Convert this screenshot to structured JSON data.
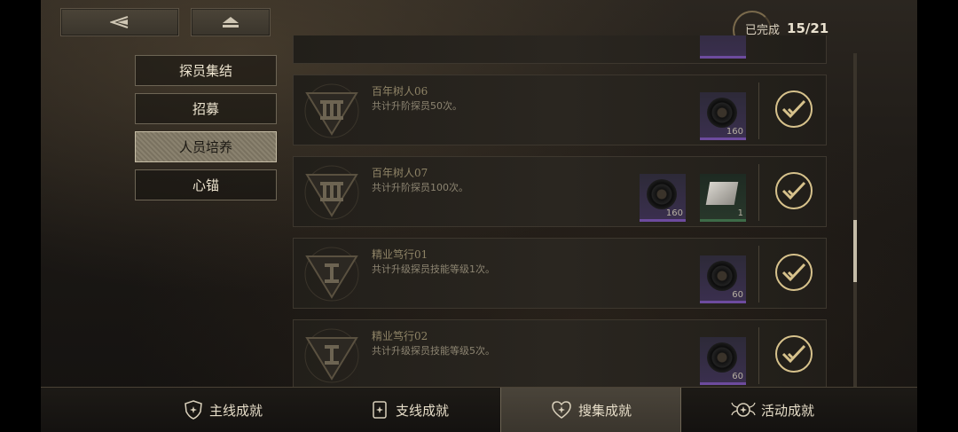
{
  "header": {
    "back_icon": "back-arrow-icon",
    "home_icon": "home-icon",
    "progress_label": "已完成",
    "progress_count": "15/21"
  },
  "sidebar": {
    "items": [
      {
        "label": "探员集结",
        "active": false
      },
      {
        "label": "招募",
        "active": false
      },
      {
        "label": "人员培养",
        "active": true
      },
      {
        "label": "心锚",
        "active": false
      }
    ]
  },
  "achievements": [
    {
      "title": "百年树人06",
      "desc": "共计升阶探员50次。",
      "emblem": "rank-III-emblem",
      "rewards": [
        {
          "icon": "record-disc",
          "qty": "160"
        }
      ],
      "completed": true
    },
    {
      "title": "百年树人07",
      "desc": "共计升阶探员100次。",
      "emblem": "rank-III-emblem",
      "rewards": [
        {
          "icon": "record-disc",
          "qty": "160"
        },
        {
          "icon": "paper-item",
          "qty": "1"
        }
      ],
      "completed": true
    },
    {
      "title": "精业笃行01",
      "desc": "共计升级探员技能等级1次。",
      "emblem": "rank-I-emblem",
      "rewards": [
        {
          "icon": "record-disc",
          "qty": "60"
        }
      ],
      "completed": true
    },
    {
      "title": "精业笃行02",
      "desc": "共计升级探员技能等级5次。",
      "emblem": "rank-I-emblem",
      "rewards": [
        {
          "icon": "record-disc",
          "qty": "60"
        }
      ],
      "completed": true
    }
  ],
  "tabs": [
    {
      "label": "主线成就",
      "icon": "shield-star-icon",
      "active": false
    },
    {
      "label": "支线成就",
      "icon": "card-star-icon",
      "active": false
    },
    {
      "label": "搜集成就",
      "icon": "heart-star-icon",
      "active": true
    },
    {
      "label": "活动成就",
      "icon": "wing-star-icon",
      "active": false
    }
  ],
  "colors": {
    "accent": "#d7c28c",
    "rare_purple": "#6d4b9e"
  }
}
